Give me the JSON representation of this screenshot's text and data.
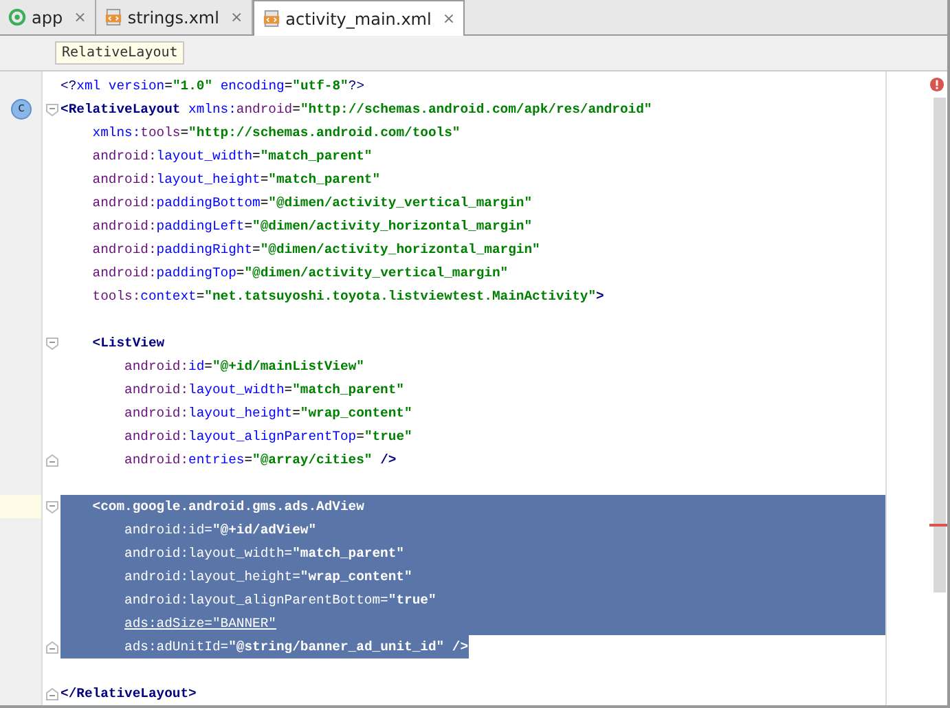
{
  "tabs": [
    {
      "label": "app",
      "kind": "module",
      "selected": false,
      "close": "×"
    },
    {
      "label": "strings.xml",
      "kind": "xml",
      "selected": false,
      "close": "×"
    },
    {
      "label": "activity_main.xml",
      "kind": "xml",
      "selected": true,
      "close": "×"
    }
  ],
  "breadcrumb": "RelativeLayout",
  "editor": {
    "has_error": true,
    "lines": [
      {
        "selected": false,
        "tokens": [
          {
            "t": "<?",
            "kind": "pi"
          },
          {
            "t": "xml ",
            "kind": "attr"
          },
          {
            "t": "version",
            "kind": "attr"
          },
          {
            "t": "=",
            "kind": "plain"
          },
          {
            "t": "\"1.0\"",
            "kind": "val"
          },
          {
            "t": " encoding",
            "kind": "attr"
          },
          {
            "t": "=",
            "kind": "plain"
          },
          {
            "t": "\"utf-8\"",
            "kind": "val"
          },
          {
            "t": "?>",
            "kind": "pi"
          }
        ]
      },
      {
        "selected": false,
        "fold_start": true,
        "badge": "c",
        "tokens": [
          {
            "t": "<RelativeLayout",
            "kind": "tag"
          },
          {
            "t": " xmlns:",
            "kind": "attr"
          },
          {
            "t": "android",
            "kind": "ns"
          },
          {
            "t": "=",
            "kind": "plain"
          },
          {
            "t": "\"http://schemas.android.com/apk/res/android\"",
            "kind": "val"
          }
        ]
      },
      {
        "selected": false,
        "tokens": [
          {
            "t": "    xmlns:",
            "kind": "attr"
          },
          {
            "t": "tools",
            "kind": "ns"
          },
          {
            "t": "=",
            "kind": "plain"
          },
          {
            "t": "\"http://schemas.android.com/tools\"",
            "kind": "val"
          }
        ]
      },
      {
        "selected": false,
        "tokens": [
          {
            "t": "    android:",
            "kind": "ns"
          },
          {
            "t": "layout_width",
            "kind": "attr"
          },
          {
            "t": "=",
            "kind": "plain"
          },
          {
            "t": "\"match_parent\"",
            "kind": "val"
          }
        ]
      },
      {
        "selected": false,
        "tokens": [
          {
            "t": "    android:",
            "kind": "ns"
          },
          {
            "t": "layout_height",
            "kind": "attr"
          },
          {
            "t": "=",
            "kind": "plain"
          },
          {
            "t": "\"match_parent\"",
            "kind": "val"
          }
        ]
      },
      {
        "selected": false,
        "tokens": [
          {
            "t": "    android:",
            "kind": "ns"
          },
          {
            "t": "paddingBottom",
            "kind": "attr"
          },
          {
            "t": "=",
            "kind": "plain"
          },
          {
            "t": "\"@dimen/activity_vertical_margin\"",
            "kind": "val"
          }
        ]
      },
      {
        "selected": false,
        "tokens": [
          {
            "t": "    android:",
            "kind": "ns"
          },
          {
            "t": "paddingLeft",
            "kind": "attr"
          },
          {
            "t": "=",
            "kind": "plain"
          },
          {
            "t": "\"@dimen/activity_horizontal_margin\"",
            "kind": "val"
          }
        ]
      },
      {
        "selected": false,
        "tokens": [
          {
            "t": "    android:",
            "kind": "ns"
          },
          {
            "t": "paddingRight",
            "kind": "attr"
          },
          {
            "t": "=",
            "kind": "plain"
          },
          {
            "t": "\"@dimen/activity_horizontal_margin\"",
            "kind": "val"
          }
        ]
      },
      {
        "selected": false,
        "tokens": [
          {
            "t": "    android:",
            "kind": "ns"
          },
          {
            "t": "paddingTop",
            "kind": "attr"
          },
          {
            "t": "=",
            "kind": "plain"
          },
          {
            "t": "\"@dimen/activity_vertical_margin\"",
            "kind": "val"
          }
        ]
      },
      {
        "selected": false,
        "tokens": [
          {
            "t": "    tools:",
            "kind": "ns"
          },
          {
            "t": "context",
            "kind": "attr"
          },
          {
            "t": "=",
            "kind": "plain"
          },
          {
            "t": "\"net.tatsuyoshi.toyota.listviewtest.MainActivity\"",
            "kind": "val"
          },
          {
            "t": ">",
            "kind": "tag"
          }
        ]
      },
      {
        "selected": false
      },
      {
        "selected": false,
        "fold_start": true,
        "tokens": [
          {
            "t": "    <ListView",
            "kind": "tag"
          }
        ]
      },
      {
        "selected": false,
        "tokens": [
          {
            "t": "        android:",
            "kind": "ns"
          },
          {
            "t": "id",
            "kind": "attr"
          },
          {
            "t": "=",
            "kind": "plain"
          },
          {
            "t": "\"@+id/mainListView\"",
            "kind": "val"
          }
        ]
      },
      {
        "selected": false,
        "tokens": [
          {
            "t": "        android:",
            "kind": "ns"
          },
          {
            "t": "layout_width",
            "kind": "attr"
          },
          {
            "t": "=",
            "kind": "plain"
          },
          {
            "t": "\"match_parent\"",
            "kind": "val"
          }
        ]
      },
      {
        "selected": false,
        "tokens": [
          {
            "t": "        android:",
            "kind": "ns"
          },
          {
            "t": "layout_height",
            "kind": "attr"
          },
          {
            "t": "=",
            "kind": "plain"
          },
          {
            "t": "\"wrap_content\"",
            "kind": "val"
          }
        ]
      },
      {
        "selected": false,
        "tokens": [
          {
            "t": "        android:",
            "kind": "ns"
          },
          {
            "t": "layout_alignParentTop",
            "kind": "attr"
          },
          {
            "t": "=",
            "kind": "plain"
          },
          {
            "t": "\"true\"",
            "kind": "val"
          }
        ]
      },
      {
        "selected": false,
        "fold_end": true,
        "tokens": [
          {
            "t": "        android:",
            "kind": "ns"
          },
          {
            "t": "entries",
            "kind": "attr"
          },
          {
            "t": "=",
            "kind": "plain"
          },
          {
            "t": "\"@array/cities\"",
            "kind": "val"
          },
          {
            "t": " />",
            "kind": "tag"
          }
        ]
      },
      {
        "selected": false
      },
      {
        "selected": true,
        "current": true,
        "fold_start": true,
        "tokens": [
          {
            "t": "    <com.google.android.gms.ads.AdView",
            "kind": "tag"
          }
        ]
      },
      {
        "selected": true,
        "tokens": [
          {
            "t": "        android:",
            "kind": "ns"
          },
          {
            "t": "id",
            "kind": "attr"
          },
          {
            "t": "=",
            "kind": "plain"
          },
          {
            "t": "\"@+id/adView\"",
            "kind": "val"
          }
        ]
      },
      {
        "selected": true,
        "tokens": [
          {
            "t": "        android:",
            "kind": "ns"
          },
          {
            "t": "layout_width",
            "kind": "attr"
          },
          {
            "t": "=",
            "kind": "plain"
          },
          {
            "t": "\"match_parent\"",
            "kind": "val"
          }
        ]
      },
      {
        "selected": true,
        "tokens": [
          {
            "t": "        android:",
            "kind": "ns"
          },
          {
            "t": "layout_height",
            "kind": "attr"
          },
          {
            "t": "=",
            "kind": "plain"
          },
          {
            "t": "\"wrap_content\"",
            "kind": "val"
          }
        ]
      },
      {
        "selected": true,
        "tokens": [
          {
            "t": "        android:",
            "kind": "ns"
          },
          {
            "t": "layout_alignParentBottom",
            "kind": "attr"
          },
          {
            "t": "=",
            "kind": "plain"
          },
          {
            "t": "\"true\"",
            "kind": "val"
          }
        ]
      },
      {
        "selected": true,
        "tokens": [
          {
            "t": "        ads:adSize=\"BANNER\"",
            "kind": "error"
          }
        ]
      },
      {
        "selected": true,
        "fold_end": true,
        "tokens": [
          {
            "t": "        ads:",
            "kind": "ns"
          },
          {
            "t": "adUnitId",
            "kind": "attr"
          },
          {
            "t": "=",
            "kind": "plain"
          },
          {
            "t": "\"@string/banner_ad_unit_id\"",
            "kind": "val"
          },
          {
            "t": " />",
            "kind": "tag"
          }
        ]
      },
      {
        "selected": false
      },
      {
        "selected": false,
        "fold_end": true,
        "tokens": [
          {
            "t": "</RelativeLayout",
            "kind": "tag"
          },
          {
            "t": ">",
            "kind": "tag"
          }
        ]
      }
    ]
  }
}
